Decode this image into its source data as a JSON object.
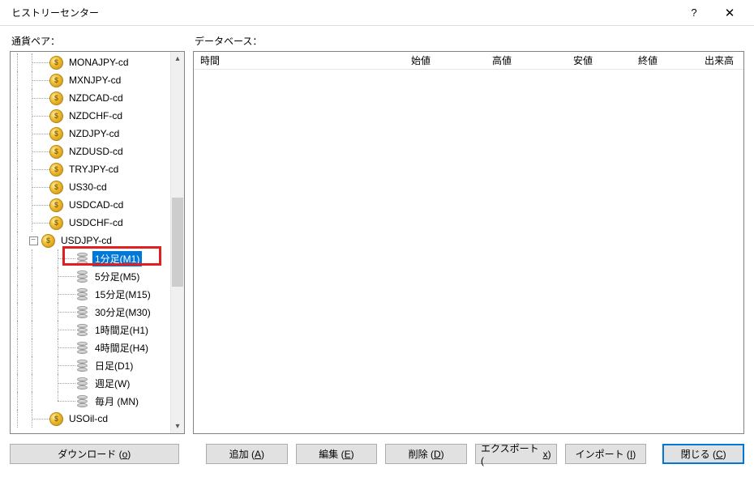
{
  "window": {
    "title": "ヒストリーセンター",
    "help": "?",
    "close": "✕"
  },
  "labels": {
    "pairs": "通貨ペア：",
    "database": "データベース："
  },
  "tree": {
    "items": [
      {
        "type": "coin",
        "label": "MONAJPY-cd"
      },
      {
        "type": "coin",
        "label": "MXNJPY-cd"
      },
      {
        "type": "coin",
        "label": "NZDCAD-cd"
      },
      {
        "type": "coin",
        "label": "NZDCHF-cd"
      },
      {
        "type": "coin",
        "label": "NZDJPY-cd"
      },
      {
        "type": "coin",
        "label": "NZDUSD-cd"
      },
      {
        "type": "coin",
        "label": "TRYJPY-cd"
      },
      {
        "type": "coin",
        "label": "US30-cd"
      },
      {
        "type": "coin",
        "label": "USDCAD-cd"
      },
      {
        "type": "coin",
        "label": "USDCHF-cd"
      },
      {
        "type": "coin",
        "label": "USDJPY-cd",
        "expanded": true
      }
    ],
    "children": [
      {
        "label": "1分足(M1)",
        "selected": true
      },
      {
        "label": "5分足(M5)"
      },
      {
        "label": "15分足(M15)"
      },
      {
        "label": "30分足(M30)"
      },
      {
        "label": "1時間足(H1)"
      },
      {
        "label": "4時間足(H4)"
      },
      {
        "label": "日足(D1)"
      },
      {
        "label": "週足(W)"
      },
      {
        "label": "毎月 (MN)"
      }
    ],
    "after": [
      {
        "type": "coin",
        "label": "USOil-cd"
      }
    ]
  },
  "columns": {
    "time": "時間",
    "open": "始値",
    "high": "高値",
    "low": "安値",
    "close": "終値",
    "volume": "出来高"
  },
  "buttons": {
    "download": {
      "t": "ダウンロード (",
      "k": "o",
      "e": ")"
    },
    "add": {
      "t": "追加 (",
      "k": "A",
      "e": ")"
    },
    "edit": {
      "t": "編集 (",
      "k": "E",
      "e": ")"
    },
    "delete": {
      "t": "削除 (",
      "k": "D",
      "e": ")"
    },
    "export": {
      "t": "エクスポート (",
      "k": "x",
      "e": ")"
    },
    "import": {
      "t": "インポート (",
      "k": "I",
      "e": ")"
    },
    "closebtn": {
      "t": "閉じる (",
      "k": "C",
      "e": ")"
    }
  },
  "icons": {
    "minus": "−",
    "dollar": "$"
  }
}
